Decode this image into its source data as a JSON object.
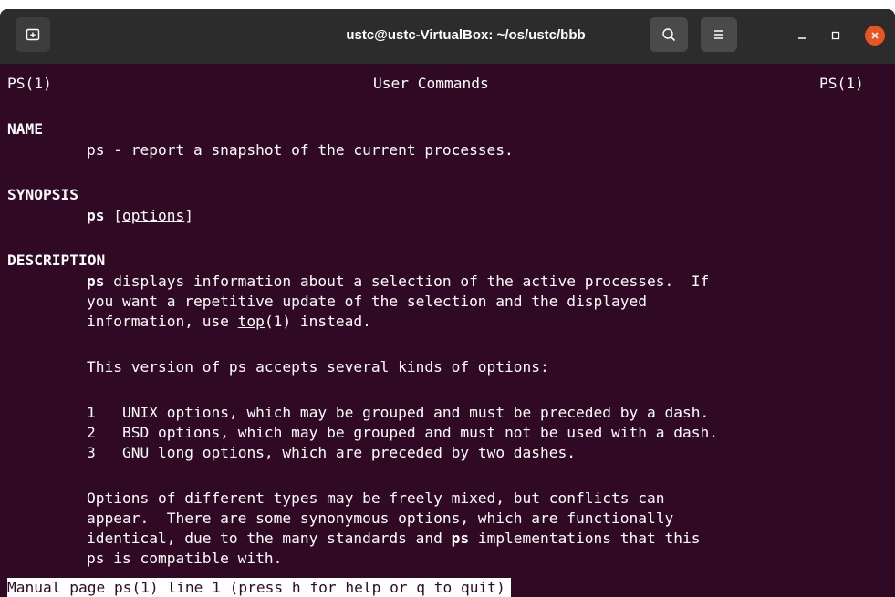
{
  "window": {
    "title": "ustc@ustc-VirtualBox: ~/os/ustc/bbb",
    "buttons": {
      "new_tab_icon": "new-tab-icon",
      "search_icon": "search-icon",
      "menu_icon": "hamburger-menu-icon",
      "minimize_icon": "minimize-icon",
      "maximize_icon": "maximize-icon",
      "close_icon": "close-icon"
    },
    "colors": {
      "terminal_bg": "#300a24",
      "titlebar_bg": "#2c2c2c",
      "close_bg": "#e95420"
    }
  },
  "man": {
    "header_left": "PS(1)",
    "header_center": "User Commands",
    "header_right": "PS(1)",
    "name_heading": "NAME",
    "name_text": "ps - report a snapshot of the current processes.",
    "synopsis_heading": "SYNOPSIS",
    "synopsis_cmd": "ps",
    "synopsis_open": "[",
    "synopsis_options": "options",
    "synopsis_close": "]",
    "description_heading": "DESCRIPTION",
    "desc1_cmd": "ps",
    "desc1_rest": " displays information about a selection of the active processes.  If",
    "desc2": "you want a repetitive update of the selection and the displayed",
    "desc3_pre": "information, use ",
    "desc3_link": "top",
    "desc3_post": "(1) instead.",
    "desc4": "This version of ps accepts several kinds of options:",
    "list": [
      {
        "num": "1",
        "text": "UNIX options, which may be grouped and must be preceded by a dash."
      },
      {
        "num": "2",
        "text": "BSD options, which may be grouped and must not be used with a dash."
      },
      {
        "num": "3",
        "text": "GNU long options, which are preceded by two dashes."
      }
    ],
    "desc5": "Options of different types may be freely mixed, but conflicts can",
    "desc6": "appear.  There are some synonymous options, which are functionally",
    "desc7_pre": "identical, due to the many standards and ",
    "desc7_cmd": "ps",
    "desc7_post": " implementations that this",
    "desc8": "ps is compatible with.",
    "status_line": "Manual page ps(1) line 1 (press h for help or q to quit)"
  }
}
